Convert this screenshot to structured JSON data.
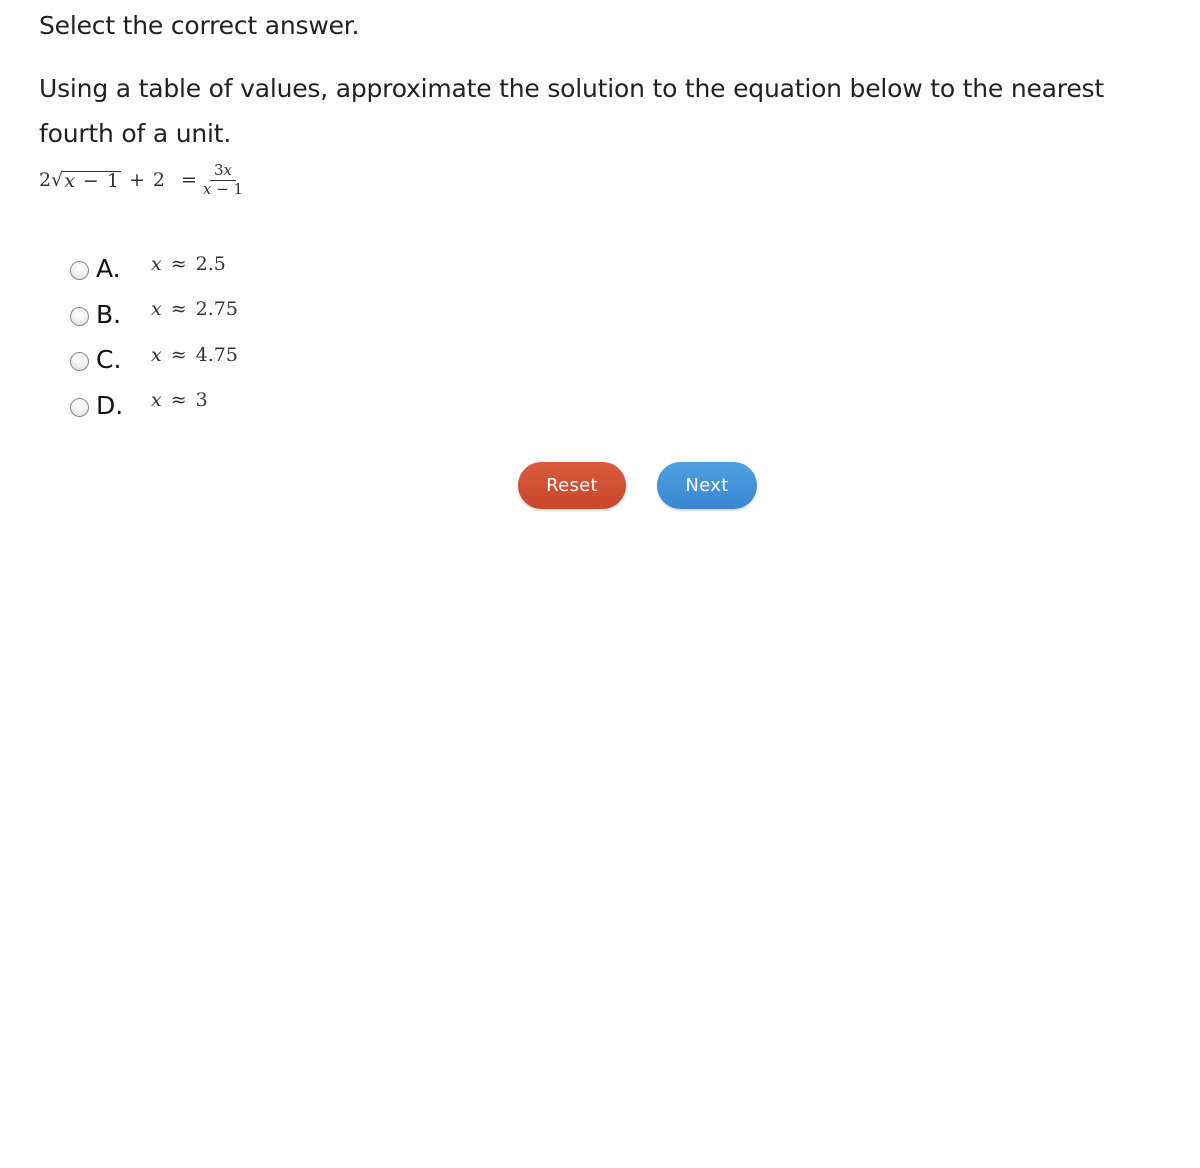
{
  "instruction": "Select the correct answer.",
  "question": "Using a table of values, approximate the solution to the equation below to the nearest fourth of a unit.",
  "equation": {
    "left_coef": "2",
    "sqrt_symbol": "√",
    "radicand_var": "x",
    "radicand_minus": "−",
    "radicand_const": "1",
    "plus": "+",
    "left_const": "2",
    "equals": "=",
    "numerator_coef": "3",
    "numerator_var": "x",
    "denominator_var": "x",
    "denominator_minus": "−",
    "denominator_const": "1"
  },
  "options": [
    {
      "letter": "A.",
      "var": "x",
      "approx": "≈",
      "value": "2.5",
      "selected": false
    },
    {
      "letter": "B.",
      "var": "x",
      "approx": "≈",
      "value": "2.75",
      "selected": false
    },
    {
      "letter": "C.",
      "var": "x",
      "approx": "≈",
      "value": "4.75",
      "selected": false
    },
    {
      "letter": "D.",
      "var": "x",
      "approx": "≈",
      "value": "3",
      "selected": false
    }
  ],
  "buttons": {
    "reset_label": "Reset",
    "next_label": "Next",
    "reset_color": "#d0503a",
    "next_color": "#4393dc"
  }
}
